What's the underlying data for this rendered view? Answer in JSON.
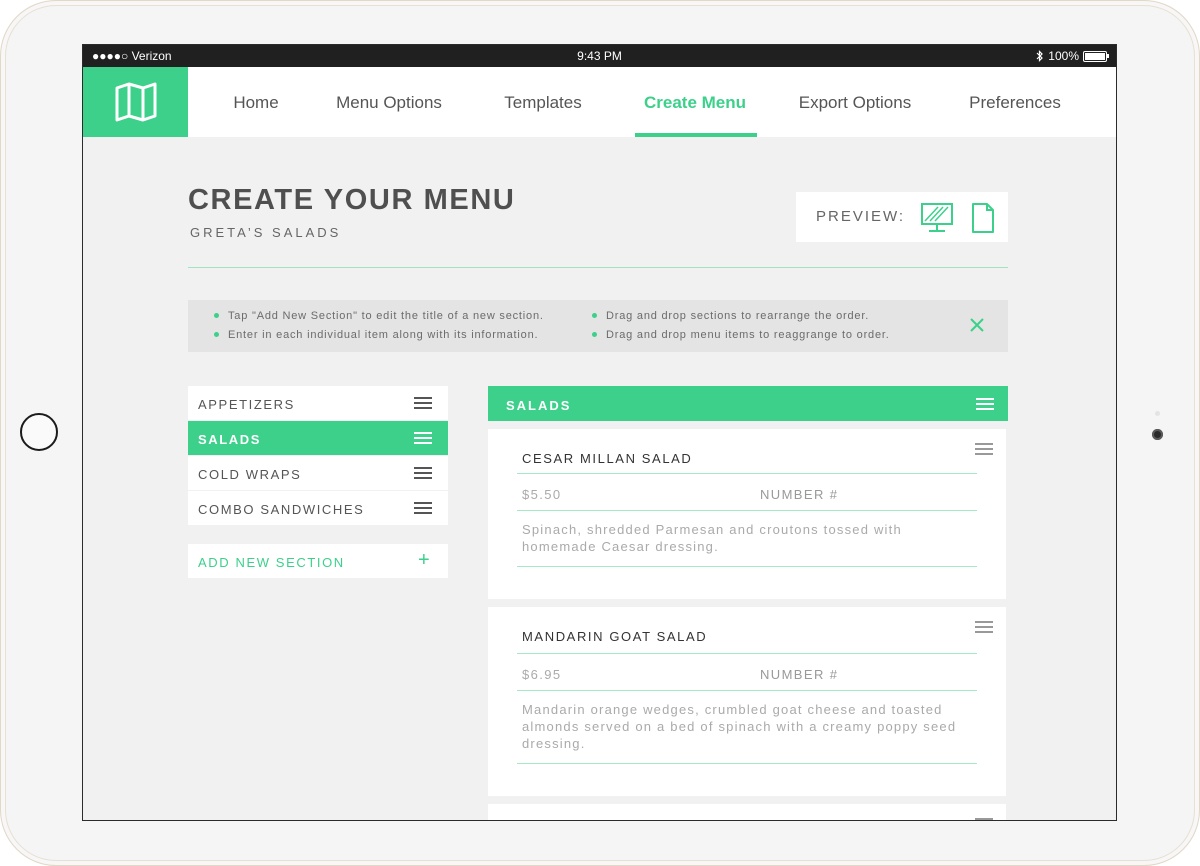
{
  "status_bar": {
    "carrier": "●●●●○ Verizon",
    "time": "9:43 PM",
    "battery": "100%",
    "bluetooth_icon": "bluetooth-icon"
  },
  "nav": {
    "logo_icon": "folded-map-icon",
    "items": [
      {
        "label": "Home",
        "active": false
      },
      {
        "label": "Menu Options",
        "active": false
      },
      {
        "label": "Templates",
        "active": false
      },
      {
        "label": "Create Menu",
        "active": true
      },
      {
        "label": "Export Options",
        "active": false
      },
      {
        "label": "Preferences",
        "active": false
      }
    ]
  },
  "page": {
    "title": "CREATE YOUR MENU",
    "subtitle": "GRETA’S SALADS",
    "preview_label": "PREVIEW:",
    "preview_icons": [
      "desktop-icon",
      "document-icon"
    ]
  },
  "tips": {
    "left": [
      "Tap \"Add New Section\" to edit the title of a new section.",
      "Enter in each individual item along with its information."
    ],
    "right": [
      "Drag and drop sections to rearrange the order.",
      "Drag and drop menu items to reaggrange to order."
    ]
  },
  "sections": {
    "items": [
      {
        "label": "APPETIZERS",
        "active": false
      },
      {
        "label": "SALADS",
        "active": true
      },
      {
        "label": "COLD WRAPS",
        "active": false
      },
      {
        "label": "COMBO SANDWICHES",
        "active": false
      }
    ],
    "add_label": "ADD NEW SECTION",
    "add_icon": "+"
  },
  "panel": {
    "header": "SALADS",
    "items": [
      {
        "name": "CESAR MILLAN SALAD",
        "price": "$5.50",
        "number_placeholder": "NUMBER #",
        "description": "Spinach, shredded Parmesan and croutons tossed with homemade Caesar dressing."
      },
      {
        "name": "MANDARIN GOAT SALAD",
        "price": "$6.95",
        "number_placeholder": "NUMBER #",
        "description": "Mandarin orange wedges, crumbled goat cheese and toasted almonds served on a bed of spinach with a creamy poppy seed dressing."
      }
    ]
  },
  "colors": {
    "accent": "#3dd08b",
    "background": "#f0f1f0",
    "text": "#555555"
  }
}
